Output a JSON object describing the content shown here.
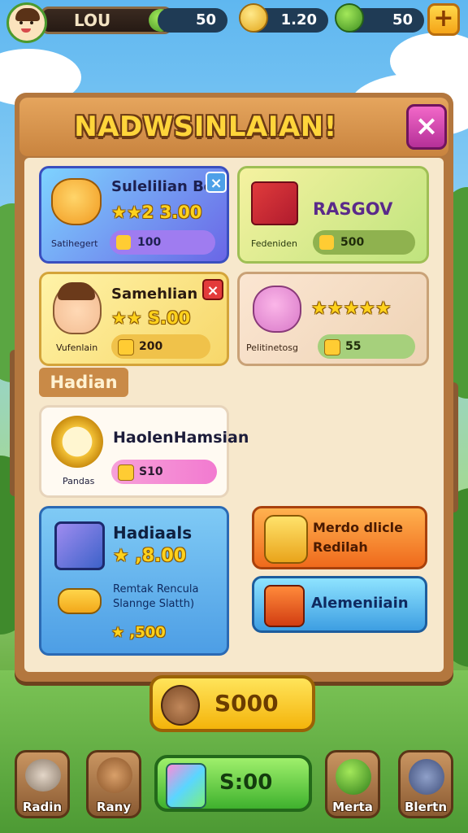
{
  "player": {
    "name": "LOU"
  },
  "resources": [
    {
      "value": "50",
      "icon": "green-gem-icon"
    },
    {
      "value": "1.20",
      "icon": "gold-coin-icon"
    },
    {
      "value": "50",
      "icon": "green-gem-icon"
    }
  ],
  "add_button": {
    "label": "+"
  },
  "panel": {
    "title": "NADWSINLAIAN!",
    "close_label": "×"
  },
  "cards": [
    {
      "title": "Sulelilian Bon",
      "price": "★★2 3.00",
      "subtitle": "Satihegert",
      "pill_value": "100",
      "close_label": "×"
    },
    {
      "title": "RASGOV",
      "subtitle": "Fedeniden",
      "pill_value": "500"
    },
    {
      "title": "Samehlian",
      "price": "★★ S.00",
      "subtitle": "Vufenlain",
      "pill_value": "200",
      "close_label": "×"
    },
    {
      "stars": "★★★★★",
      "subtitle": "Pelitinetosg",
      "pill_value": "55"
    }
  ],
  "section_label": "Hadian",
  "feature_card": {
    "title": "HaolenHamsian",
    "subtitle": "Pandas",
    "pill_value": "S10"
  },
  "blue_card": {
    "title": "Hadiaals",
    "price": "★ ,8.00",
    "desc_line1": "Remtak Rencula",
    "desc_line2": "Slannge Slatth)",
    "bottom_price": "★ ,500"
  },
  "side_buttons": {
    "orange": {
      "line1": "Merdo dlicle",
      "line2": "Redilah"
    },
    "blue": {
      "label": "Alemeniiain"
    }
  },
  "big_button": {
    "label": "S000"
  },
  "bottom_nav": [
    {
      "label": "Radin"
    },
    {
      "label": "Rany"
    },
    {
      "label": "Merta"
    },
    {
      "label": "Blertn"
    }
  ],
  "center_button": {
    "label": "S:00"
  },
  "colors": {
    "panel_wood": "#b3773e",
    "panel_inner": "#f7e8cc",
    "title_yellow": "#ffd53b",
    "close_pink": "#e04fb9"
  }
}
